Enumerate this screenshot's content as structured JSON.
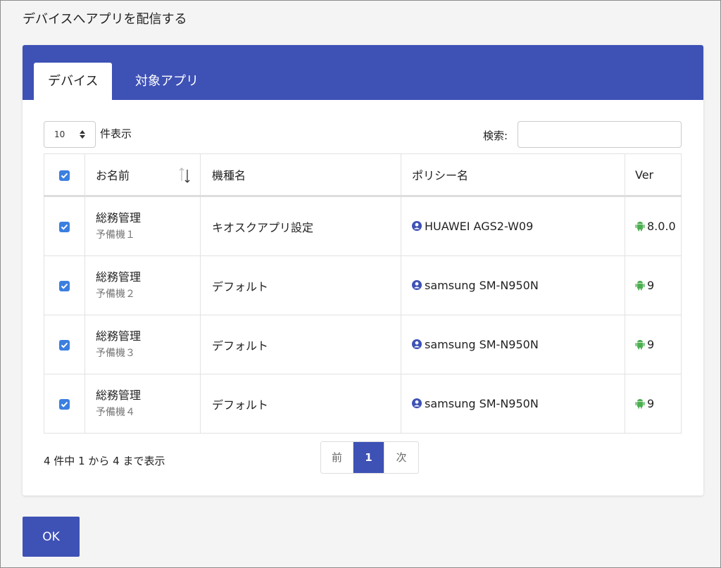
{
  "dialog": {
    "title": "デバイスへアプリを配信する"
  },
  "tabs": [
    {
      "label": "デバイス",
      "active": true
    },
    {
      "label": "対象アプリ",
      "active": false
    }
  ],
  "length": {
    "value": "10",
    "label": "件表示"
  },
  "search": {
    "label": "検索:",
    "value": "",
    "placeholder": ""
  },
  "table": {
    "headers": {
      "name": "お名前",
      "model": "機種名",
      "policy": "ポリシー名",
      "ver": "Ver"
    },
    "rows": [
      {
        "checked": true,
        "name": "総務管理",
        "sub": "予備機１",
        "model": "キオスクアプリ設定",
        "policy": "HUAWEI AGS2-W09",
        "ver": "8.0.0"
      },
      {
        "checked": true,
        "name": "総務管理",
        "sub": "予備機２",
        "model": "デフォルト",
        "policy": "samsung SM-N950N",
        "ver": "9"
      },
      {
        "checked": true,
        "name": "総務管理",
        "sub": "予備機３",
        "model": "デフォルト",
        "policy": "samsung SM-N950N",
        "ver": "9"
      },
      {
        "checked": true,
        "name": "総務管理",
        "sub": "予備機４",
        "model": "デフォルト",
        "policy": "samsung SM-N950N",
        "ver": "9"
      }
    ]
  },
  "info": "4 件中 1 から 4 まで表示",
  "pagination": {
    "prev": "前",
    "current": "1",
    "next": "次"
  },
  "footer": {
    "ok_label": "OK"
  },
  "colors": {
    "primary": "#3e51b5",
    "checkbox": "#3b7fe0",
    "android": "#4caf50"
  },
  "icons": {
    "policy": "user-circle-icon",
    "ver": "android-icon",
    "sort": "sort-icon"
  }
}
